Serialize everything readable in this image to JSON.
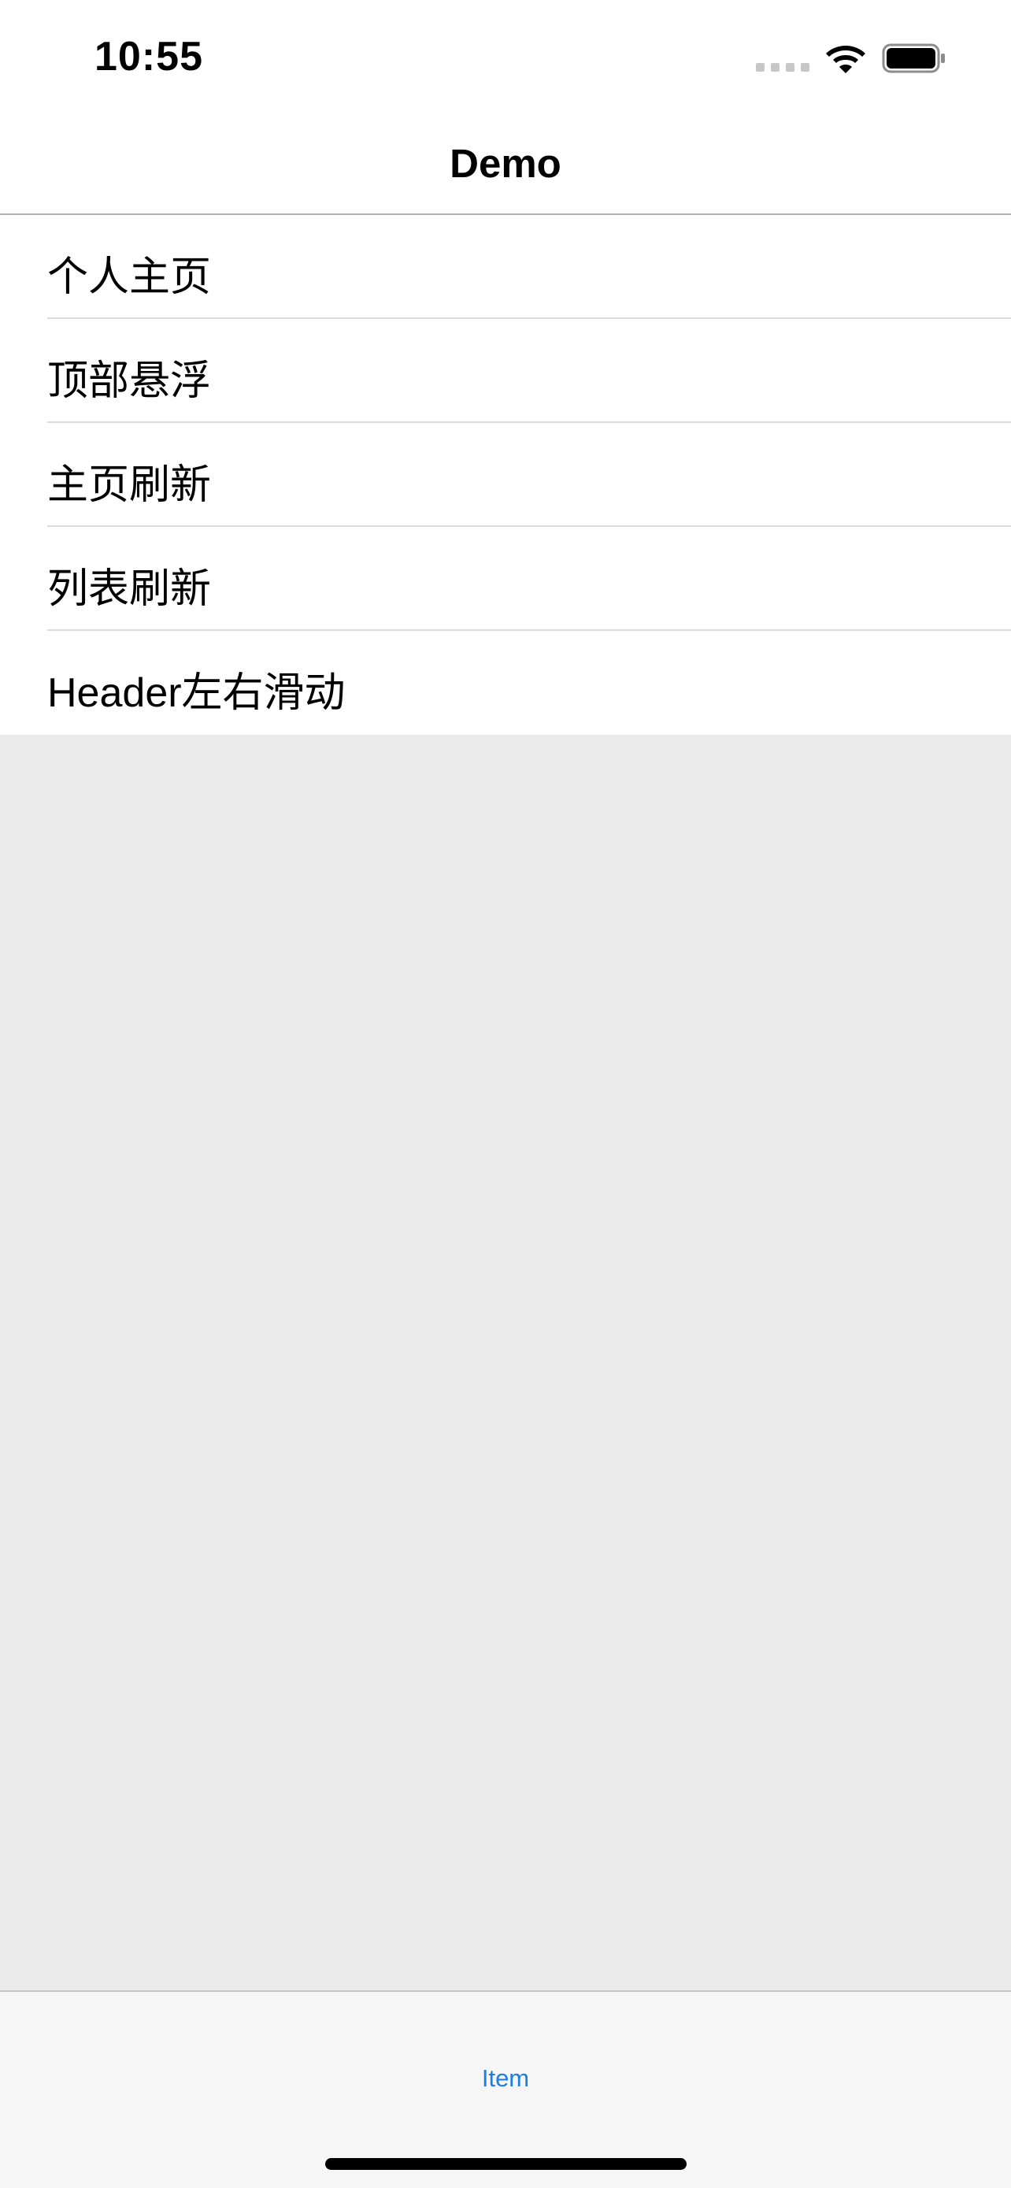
{
  "status_bar": {
    "time": "10:55",
    "icons": [
      "signal-dots-icon",
      "wifi-icon",
      "battery-icon"
    ]
  },
  "nav": {
    "title": "Demo"
  },
  "list": {
    "items": [
      {
        "label": "个人主页"
      },
      {
        "label": "顶部悬浮"
      },
      {
        "label": "主页刷新"
      },
      {
        "label": "列表刷新"
      },
      {
        "label": "Header左右滑动"
      }
    ]
  },
  "tab_bar": {
    "items": [
      {
        "label": "Item"
      }
    ]
  },
  "colors": {
    "background": "#ebebeb",
    "tab_accent": "#1a7ee4",
    "separator": "#dcdcdc"
  }
}
